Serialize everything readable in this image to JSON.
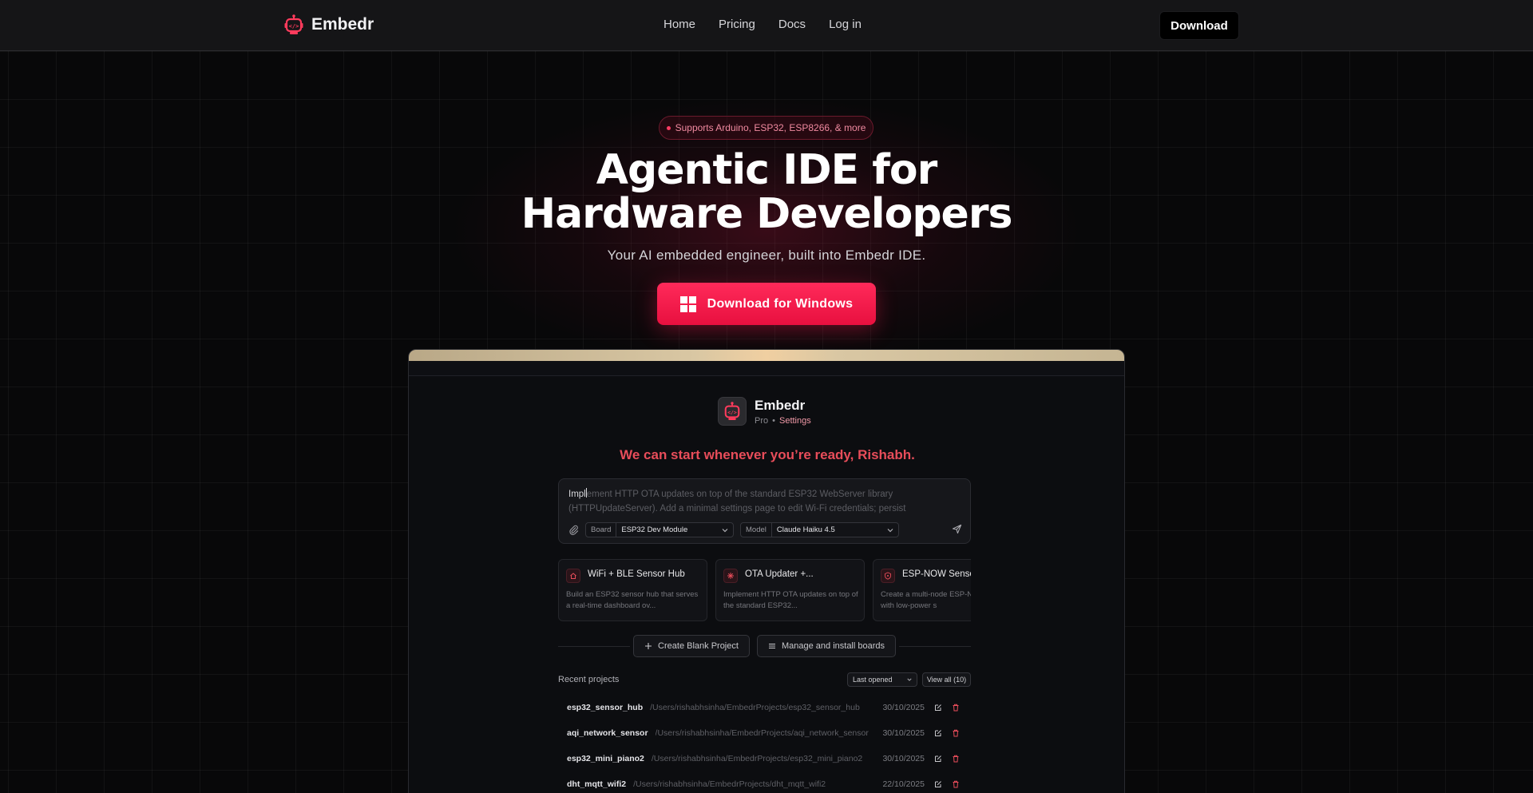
{
  "nav": {
    "brand": "Embedr",
    "links": [
      "Home",
      "Pricing",
      "Docs",
      "Log in"
    ],
    "download_label": "Download"
  },
  "hero": {
    "badge": "Supports Arduino, ESP32, ESP8266, & more",
    "title_line1": "Agentic IDE for",
    "title_line2": "Hardware Developers",
    "subtitle": "Your AI embedded engineer, built into Embedr IDE.",
    "cta_label": "Download for Windows"
  },
  "app": {
    "name": "Embedr",
    "plan": "Pro",
    "settings_label": "Settings",
    "greeting": "We can start whenever you’re ready, Rishabh.",
    "prompt": {
      "typed": "Impl",
      "ghost": "ement HTTP OTA updates on top of the standard ESP32 WebServer library (HTTPUpdateServer). Add a minimal settings page to edit Wi-Fi credentials; persist"
    },
    "board_label": "Board",
    "board_value": "ESP32 Dev Module",
    "model_label": "Model",
    "model_value": "Claude Haiku 4.5",
    "cards": [
      {
        "title": "WiFi + BLE Sensor Hub",
        "desc": "Build an ESP32 sensor hub that serves a real-time dashboard ov..."
      },
      {
        "title": "OTA Updater +...",
        "desc": "Implement HTTP OTA updates on top of the standard ESP32..."
      },
      {
        "title": "ESP-NOW Sensor",
        "desc": "Create a multi-node ESP-NOW network with low-power s"
      }
    ],
    "create_blank": "Create Blank Project",
    "manage_boards": "Manage and install boards",
    "recent_label": "Recent projects",
    "sort_value": "Last opened",
    "view_all": "View all (10)",
    "projects": [
      {
        "name": "esp32_sensor_hub",
        "path": "/Users/rishabhsinha/EmbedrProjects/esp32_sensor_hub",
        "date": "30/10/2025"
      },
      {
        "name": "aqi_network_sensor",
        "path": "/Users/rishabhsinha/EmbedrProjects/aqi_network_sensor",
        "date": "30/10/2025"
      },
      {
        "name": "esp32_mini_piano2",
        "path": "/Users/rishabhsinha/EmbedrProjects/esp32_mini_piano2",
        "date": "30/10/2025"
      },
      {
        "name": "dht_mqtt_wifi2",
        "path": "/Users/rishabhsinha/EmbedrProjects/dht_mqtt_wifi2",
        "date": "22/10/2025"
      }
    ]
  },
  "colors": {
    "accent": "#ff2a5a",
    "greeting": "#e84d5a",
    "background": "#080809"
  },
  "icons": [
    "robot-icon",
    "windows-icon",
    "paperclip-icon",
    "send-icon",
    "chevron-down-icon",
    "plus-icon",
    "list-icon",
    "edit-icon",
    "trash-icon"
  ]
}
